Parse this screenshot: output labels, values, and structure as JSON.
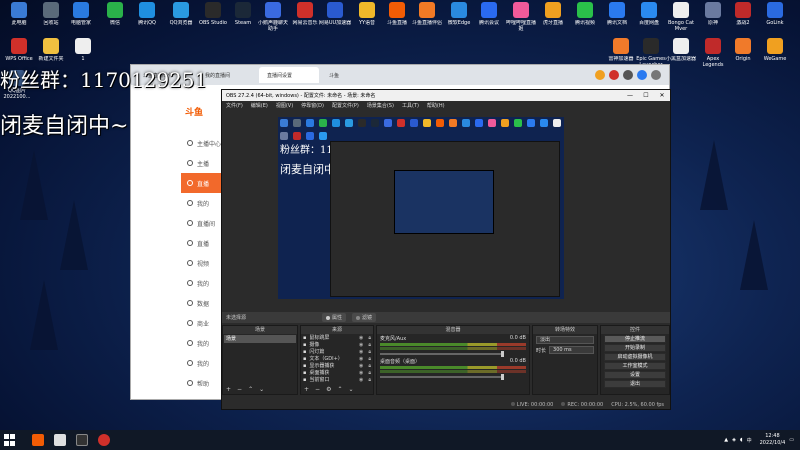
{
  "overlay": {
    "line1": "粉丝群：1170129251",
    "line2": "闭麦自闭中~"
  },
  "desktop_icons_top": [
    {
      "label": "此电脑",
      "icon": "computer-icon",
      "color": "#3a7bd5"
    },
    {
      "label": "回收站",
      "icon": "recycle-bin-icon",
      "color": "#5a6a7a"
    },
    {
      "label": "电脑管家",
      "icon": "pc-manager-icon",
      "color": "#2a7ae0"
    },
    {
      "label": "微信",
      "icon": "wechat-icon",
      "color": "#2ab24a"
    },
    {
      "label": "腾讯QQ",
      "icon": "qq-icon",
      "color": "#1f8fe0"
    },
    {
      "label": "QQ浏览器",
      "icon": "qq-browser-icon",
      "color": "#2a9ae0"
    },
    {
      "label": "OBS Studio",
      "icon": "obs-icon",
      "color": "#2a2a2a"
    },
    {
      "label": "Steam",
      "icon": "steam-icon",
      "color": "#1b2838"
    },
    {
      "label": "小鹅声鹿聊天助手",
      "icon": "chat-assistant-icon",
      "color": "#3a6ae0"
    },
    {
      "label": "网易云音乐",
      "icon": "netease-music-icon",
      "color": "#d0302a"
    },
    {
      "label": "网易UU加速器",
      "icon": "uu-booster-icon",
      "color": "#2a5ad0"
    },
    {
      "label": "YY语音",
      "icon": "yy-voice-icon",
      "color": "#f0b82a"
    },
    {
      "label": "斗鱼直播",
      "icon": "douyu-icon",
      "color": "#f25c05"
    },
    {
      "label": "斗鱼直播伴侣",
      "icon": "douyu-companion-icon",
      "color": "#f27a25"
    },
    {
      "label": "微软Edge",
      "icon": "edge-icon",
      "color": "#2a8ae0"
    },
    {
      "label": "腾讯会议",
      "icon": "tencent-meeting-icon",
      "color": "#2a6af0"
    },
    {
      "label": "哔哩哔哩直播姬",
      "icon": "bilibili-icon",
      "color": "#f05a9a"
    },
    {
      "label": "虎牙直播",
      "icon": "huya-icon",
      "color": "#f0a020"
    },
    {
      "label": "腾讯视频",
      "icon": "tencent-video-icon",
      "color": "#2ac04a"
    },
    {
      "label": "腾讯文档",
      "icon": "tencent-docs-icon",
      "color": "#2a7af0"
    },
    {
      "label": "百度网盘",
      "icon": "baidu-netdisk-icon",
      "color": "#2a8af0"
    },
    {
      "label": "Bongo Cat Mver",
      "icon": "bongo-cat-icon",
      "color": "#eeeeee"
    },
    {
      "label": "原神",
      "icon": "genshin-icon",
      "color": "#6a7aa0"
    },
    {
      "label": "激战2",
      "icon": "gw2-icon",
      "color": "#c02a2a"
    },
    {
      "label": "GoLink",
      "icon": "golink-icon",
      "color": "#2a6ae0"
    },
    {
      "label": "QQ游戏",
      "icon": "qq-game-icon",
      "color": "#2a9af0"
    }
  ],
  "desktop_icons_row2_left": [
    {
      "label": "WPS Office",
      "icon": "wps-icon",
      "color": "#d0302a"
    },
    {
      "label": "新建文件夹",
      "icon": "folder-icon",
      "color": "#f0c040"
    },
    {
      "label": "1",
      "icon": "file-icon",
      "color": "#eeeeee"
    }
  ],
  "desktop_icons_row2_right": [
    {
      "label": "雷神加速器",
      "icon": "leishen-icon",
      "color": "#f07a2a"
    },
    {
      "label": "Epic Games Launcher",
      "icon": "epic-icon",
      "color": "#2a2a2a"
    },
    {
      "label": "小黑盒加速器",
      "icon": "xiaoheihe-icon",
      "color": "#eeeeee"
    },
    {
      "label": "Apex Legends",
      "icon": "apex-icon",
      "color": "#c02a2a"
    },
    {
      "label": "Origin",
      "icon": "origin-icon",
      "color": "#f07a2a"
    },
    {
      "label": "WeGame",
      "icon": "wegame-icon",
      "color": "#f0a020"
    }
  ],
  "qq_tile": {
    "label": "QQ图片2022100..."
  },
  "browser": {
    "tabs": [
      "斗鱼直播伙伴",
      "我的直播间",
      "直播间设置",
      "斗鱼"
    ],
    "logo": "斗鱼",
    "side_items": [
      "主播中心",
      "主播",
      "直播",
      "我的",
      "直播间",
      "直播",
      "视频",
      "我的",
      "数据",
      "商业",
      "我的",
      "我的",
      "帮助"
    ]
  },
  "obs": {
    "title": "OBS 27.2.4 (64-bit, windows) - 配置文件: 未命名 - 场景: 未命名",
    "menu": [
      "文件(F)",
      "编辑(E)",
      "视图(V)",
      "停靠窗(D)",
      "配置文件(P)",
      "场景集合(S)",
      "工具(T)",
      "帮助(H)"
    ],
    "no_source": "未选择源",
    "properties_btn": "属性",
    "filters_btn": "滤镜",
    "preview_text1": "粉丝群：1170129251",
    "preview_text2": "闭麦自闭中~",
    "docks": {
      "scenes": {
        "title": "场景",
        "items": [
          "场景"
        ]
      },
      "sources": {
        "title": "来源",
        "items": [
          {
            "name": "鼠标跳屏",
            "icon": "monitor-icon"
          },
          {
            "name": "摄像",
            "icon": "camera-icon"
          },
          {
            "name": "闪灯篇",
            "icon": "image-icon"
          },
          {
            "name": "文本（GDI+）",
            "icon": "text-icon"
          },
          {
            "name": "显示器捕获",
            "icon": "display-icon"
          },
          {
            "name": "桌面捕获",
            "icon": "text-icon"
          },
          {
            "name": "当前窗口",
            "icon": "image-icon"
          }
        ]
      },
      "mixer": {
        "title": "混音器",
        "tracks": [
          {
            "name": "麦克风/Aux",
            "db": "0.0 dB"
          },
          {
            "name": "桌面音频（桌面）",
            "db": "0.0 dB"
          }
        ]
      },
      "transitions": {
        "title": "转场特效",
        "type": "淡出",
        "duration_label": "时长",
        "duration": "300 ms"
      },
      "controls": {
        "title": "控件",
        "buttons": [
          "停止推流",
          "开始录制",
          "启动虚拟摄像机",
          "工作室模式",
          "设置",
          "退出"
        ]
      }
    },
    "status": {
      "live_label": "LIVE:",
      "live_time": "00:00:00",
      "rec_label": "REC:",
      "rec_time": "00:00:00",
      "cpu": "CPU: 2.5%, 60.00 fps"
    }
  },
  "taskbar": {
    "time": "12:48",
    "date": "2022/10/4",
    "ime": "中"
  }
}
